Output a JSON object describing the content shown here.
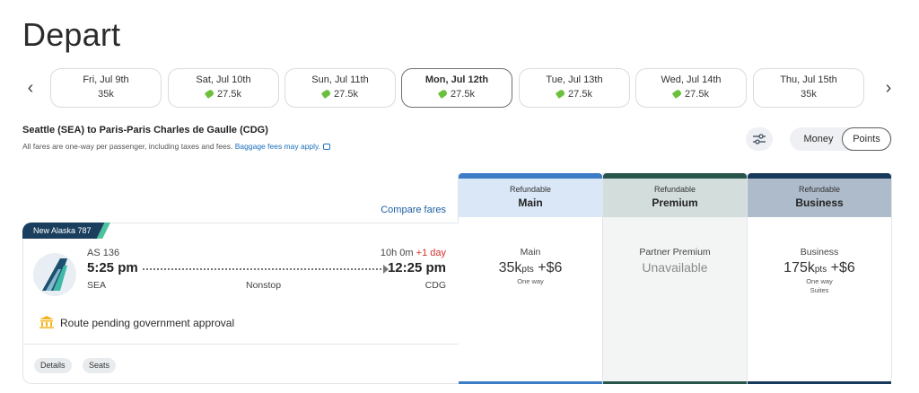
{
  "page_title": "Depart",
  "dates": [
    {
      "label": "Fri, Jul 9th",
      "price": "35k",
      "tagged": false,
      "selected": false
    },
    {
      "label": "Sat, Jul 10th",
      "price": "27.5k",
      "tagged": true,
      "selected": false
    },
    {
      "label": "Sun, Jul 11th",
      "price": "27.5k",
      "tagged": true,
      "selected": false
    },
    {
      "label": "Mon, Jul 12th",
      "price": "27.5k",
      "tagged": true,
      "selected": true
    },
    {
      "label": "Tue, Jul 13th",
      "price": "27.5k",
      "tagged": true,
      "selected": false
    },
    {
      "label": "Wed, Jul 14th",
      "price": "27.5k",
      "tagged": true,
      "selected": false
    },
    {
      "label": "Thu, Jul 15th",
      "price": "35k",
      "tagged": false,
      "selected": false
    }
  ],
  "nav": {
    "prev_icon": "chevron-left-icon",
    "next_icon": "chevron-right-icon",
    "prev": "‹",
    "next": "›"
  },
  "route": {
    "title": "Seattle (SEA) to Paris-Paris Charles de Gaulle (CDG)",
    "note": "All fares are one-way per passenger, including taxes and fees. ",
    "baggage_link": "Baggage fees may apply."
  },
  "toggle": {
    "money": "Money",
    "points": "Points",
    "active": "points"
  },
  "compare_fares": "Compare fares",
  "fare_columns": {
    "main": {
      "refundable": "Refundable",
      "cabin": "Main",
      "fare_name": "Main",
      "points": "35k",
      "pts_unit": "pts",
      "cash": "+$6",
      "sub": "One way",
      "sub2": ""
    },
    "premium": {
      "refundable": "Refundable",
      "cabin": "Premium",
      "fare_name": "Partner Premium",
      "status": "Unavailable"
    },
    "business": {
      "refundable": "Refundable",
      "cabin": "Business",
      "fare_name": "Business",
      "points": "175k",
      "pts_unit": "pts",
      "cash": "+$6",
      "sub": "One way",
      "sub2": "Suites"
    }
  },
  "flight": {
    "badge": "New Alaska 787",
    "number": "AS 136",
    "duration": "10h 0m",
    "plus_day": "+1 day",
    "depart_time": "5:25 pm",
    "arrive_time": "12:25 pm",
    "origin": "SEA",
    "stops": "Nonstop",
    "destination": "CDG",
    "notice": "Route pending government approval",
    "details_label": "Details",
    "seats_label": "Seats"
  },
  "colors": {
    "main": "#3d7cc6",
    "premium": "#27544b",
    "business": "#16395c",
    "link": "#1c5fa5",
    "plus_day": "#d2322d",
    "deal_tag": "#6cbf3b"
  }
}
